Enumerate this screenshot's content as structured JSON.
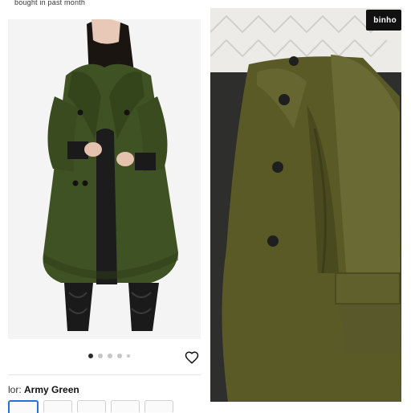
{
  "header": {
    "partial_text": "bought in past month"
  },
  "gallery": {
    "page_dots": 5,
    "active_index": 0
  },
  "product": {
    "color_label": "lor: ",
    "color_value": "Army Green"
  },
  "photo_review": {
    "brand_sign": "binho"
  },
  "colors": {
    "coat": "#3f5224",
    "coat_dark": "#2d3c18",
    "coat_review": "#5a5a26",
    "accent": "#2a6fdb"
  }
}
